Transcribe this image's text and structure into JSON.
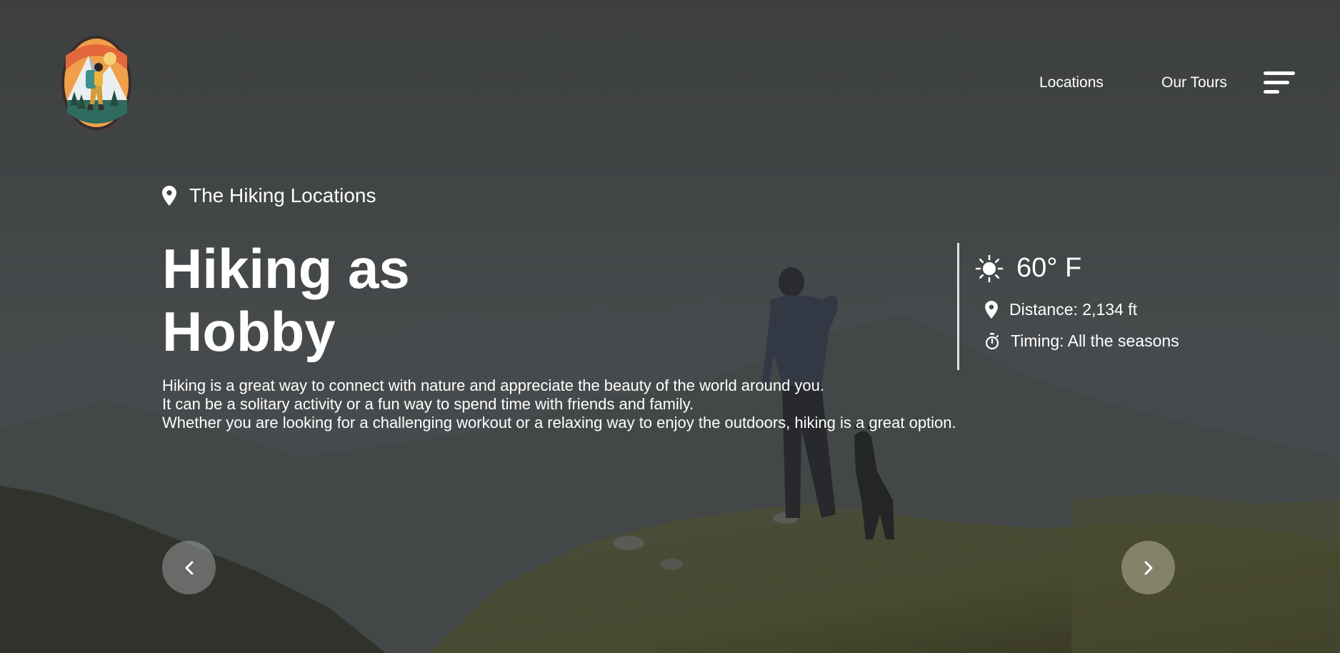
{
  "header": {
    "logo_icon": "hiker-mountain-badge-icon",
    "nav": [
      {
        "label": "Locations"
      },
      {
        "label": "Our Tours"
      }
    ],
    "menu_icon": "hamburger-menu-icon"
  },
  "hero": {
    "location_icon": "map-pin-icon",
    "location_label": "The Hiking Locations",
    "title_line1": "Hiking as",
    "title_line2": "Hobby",
    "description": [
      "Hiking is a great way to connect with nature and appreciate the beauty of the world around you.",
      "It can be a solitary activity or a fun way to spend time with friends and family.",
      "Whether you are looking for a challenging workout or a relaxing way to enjoy the outdoors, hiking is a great option."
    ]
  },
  "info": {
    "temperature": "60° F",
    "temperature_icon": "sun-icon",
    "distance": "Distance: 2,134 ft",
    "distance_icon": "map-pin-icon",
    "timing": "Timing: All the seasons",
    "timing_icon": "stopwatch-icon"
  },
  "carousel": {
    "prev_icon": "chevron-left-icon",
    "next_icon": "chevron-right-icon"
  },
  "colors": {
    "text": "#ffffff",
    "overlay": "#4a4d4d",
    "grass": "#6b6a35"
  }
}
